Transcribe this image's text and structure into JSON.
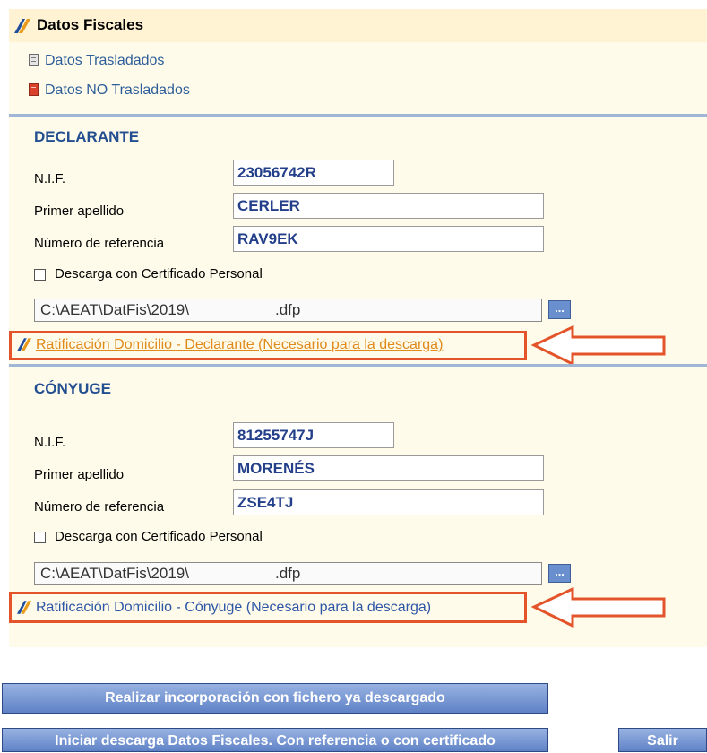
{
  "header": {
    "title": "Datos Fiscales"
  },
  "nav": {
    "trasladados": "Datos Trasladados",
    "no_trasladados": "Datos NO Trasladados"
  },
  "declarante": {
    "heading": "DECLARANTE",
    "nif_label": "N.I.F.",
    "nif_value": "23056742R",
    "apellido_label": "Primer apellido",
    "apellido_value": "CERLER",
    "referencia_label": "Número de referencia",
    "referencia_value": "RAV9EK",
    "certificado_label": "Descarga con Certificado Personal",
    "file_path": "C:\\AEAT\\DatFis\\2019\\",
    "file_ext": ".dfp",
    "ratificacion": "Ratificación Domicilio - Declarante (Necesario para la descarga)"
  },
  "conyuge": {
    "heading": "CÓNYUGE",
    "nif_label": "N.I.F.",
    "nif_value": "81255747J",
    "apellido_label": "Primer apellido",
    "apellido_value": "MORENÉS",
    "referencia_label": "Número de referencia",
    "referencia_value": "ZSE4TJ",
    "certificado_label": "Descarga con Certificado Personal",
    "file_path": "C:\\AEAT\\DatFis\\2019\\",
    "file_ext": ".dfp",
    "ratificacion": "Ratificación Domicilio - Cónyuge (Necesario para la descarga)"
  },
  "browse_label": "...",
  "buttons": {
    "incorporacion": "Realizar incorporación con fichero ya descargado",
    "descarga": "Iniciar descarga Datos Fiscales. Con referencia o con certificado",
    "salir": "Salir"
  },
  "colors": {
    "header_bg": "#fff3d3",
    "panel_bg": "#fffbea",
    "highlight_red": "#e4542b",
    "button_blue": "#5f82c6"
  }
}
